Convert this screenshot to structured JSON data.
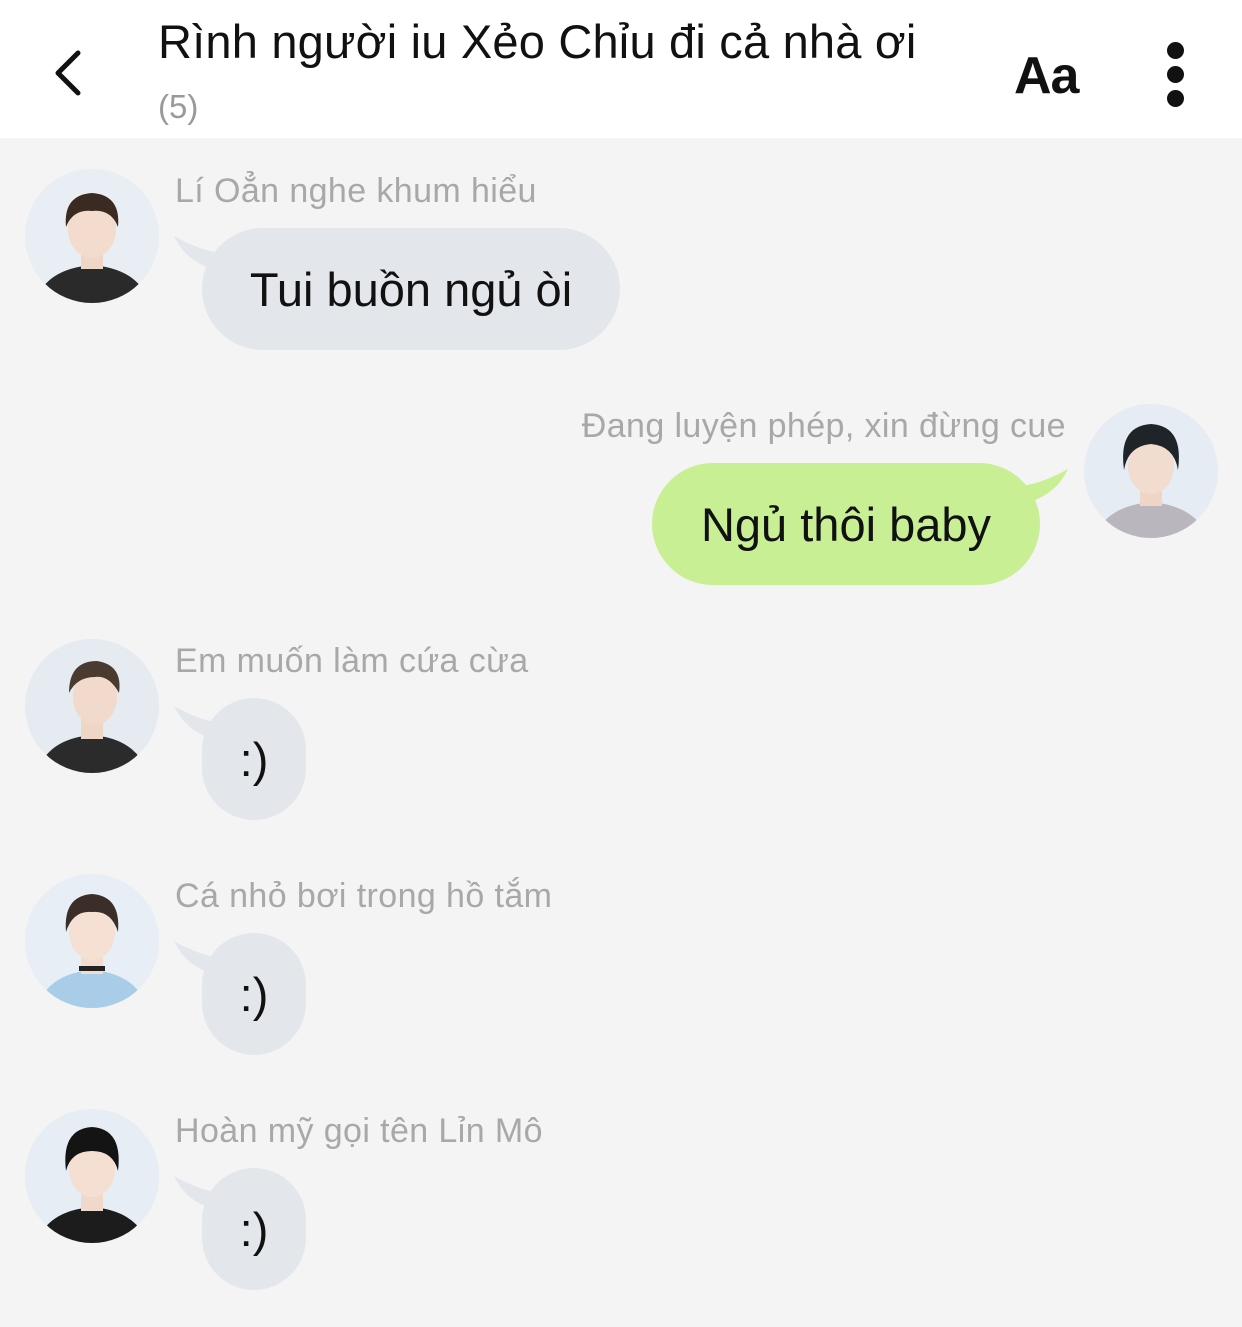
{
  "header": {
    "back_icon": "chevron-left-icon",
    "title": "Rình người iu Xẻo Chỉu đi cả nhà ơi",
    "member_count": "(5)",
    "font_size_label": "Aa",
    "more_icon": "vertical-dots-icon"
  },
  "colors": {
    "background": "#f4f4f4",
    "header": "#ffffff",
    "incoming_bubble": "#e3e7ec",
    "outgoing_bubble": "#c9ef94",
    "sender_name": "#a8a8a8"
  },
  "messages": [
    {
      "sender": "Lí Oẳn nghe khum hiểu",
      "text": "Tui buồn ngủ òi",
      "direction": "incoming"
    },
    {
      "sender": "Đang luyện phép, xin đừng cue",
      "text": "Ngủ thôi baby",
      "direction": "outgoing"
    },
    {
      "sender": "Em muốn làm cứa cừa",
      "text": ":)",
      "direction": "incoming"
    },
    {
      "sender": "Cá nhỏ bơi trong hồ tắm",
      "text": ":)",
      "direction": "incoming"
    },
    {
      "sender": "Hoàn mỹ gọi tên Lỉn Mô",
      "text": ":)",
      "direction": "incoming"
    }
  ]
}
